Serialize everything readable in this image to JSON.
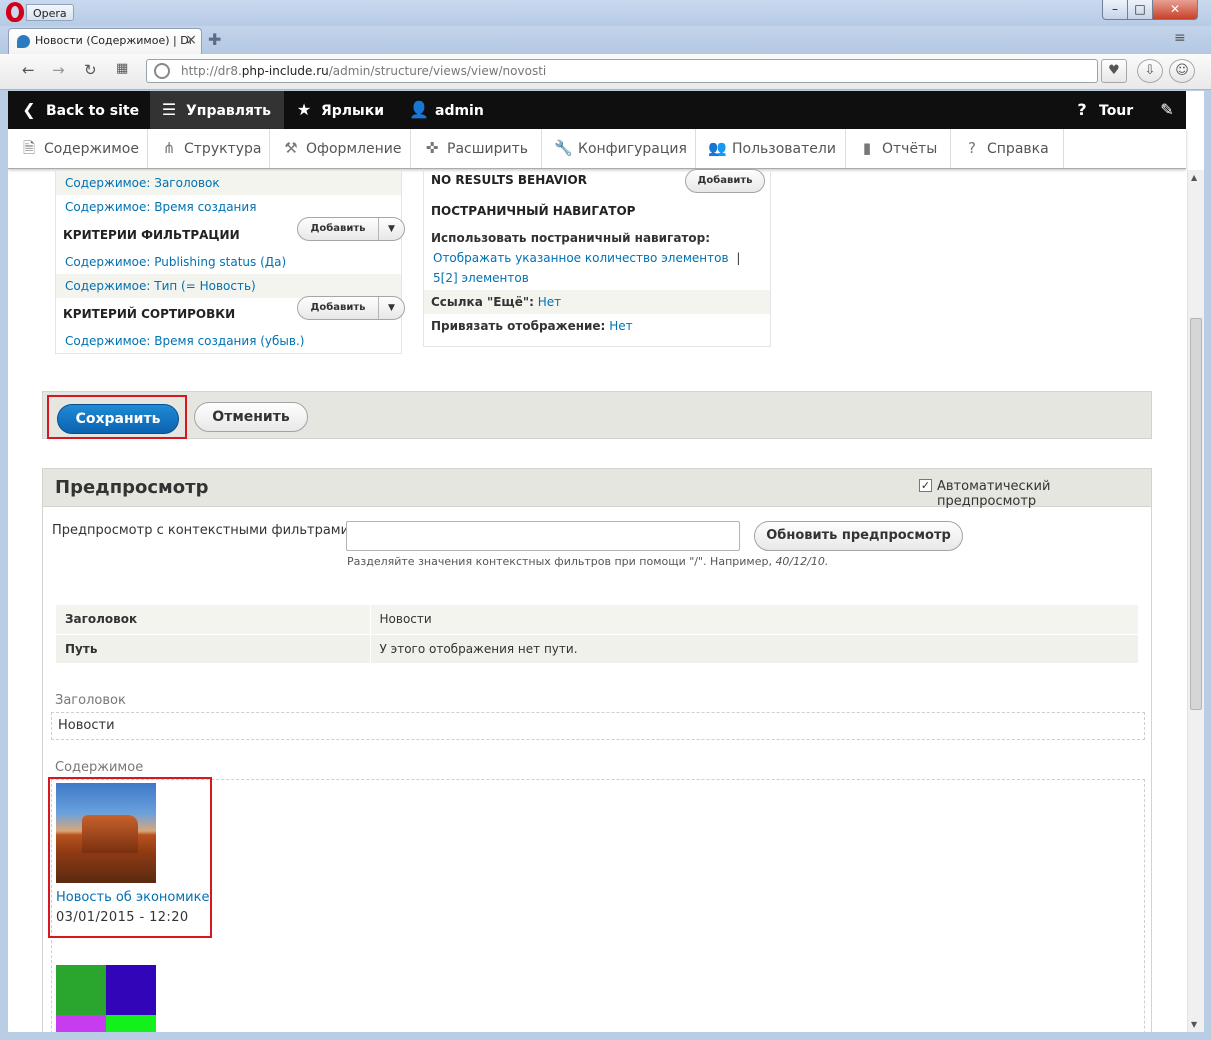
{
  "browser": {
    "app_name": "Opera",
    "tab_title": "Новости (Содержимое) | Dr",
    "url_prefix": "http://dr8.",
    "url_host": "php-include.ru",
    "url_path": "/admin/structure/views/view/novosti",
    "icons": [
      "back-icon",
      "forward-icon",
      "reload-icon",
      "speed-dial-icon",
      "heart-icon",
      "download-icon",
      "user-icon"
    ]
  },
  "toolbar": {
    "back_to_site": "Back to site",
    "manage": "Управлять",
    "shortcuts": "Ярлыки",
    "user": "admin",
    "tour": "Tour"
  },
  "tray": {
    "items": [
      {
        "label": "Содержимое",
        "icon": "document-icon"
      },
      {
        "label": "Структура",
        "icon": "sitemap-icon"
      },
      {
        "label": "Оформление",
        "icon": "wrench-brush-icon"
      },
      {
        "label": "Расширить",
        "icon": "puzzle-icon"
      },
      {
        "label": "Конфигурация",
        "icon": "wrench-icon"
      },
      {
        "label": "Пользователи",
        "icon": "people-icon"
      },
      {
        "label": "Отчёты",
        "icon": "bar-chart-icon"
      },
      {
        "label": "Справка",
        "icon": "help-icon"
      }
    ]
  },
  "views": {
    "fields": [
      "Содержимое: Заголовок",
      "Содержимое: Время создания"
    ],
    "filter_heading": "КРИТЕРИИ ФИЛЬТРАЦИИ",
    "filters": [
      "Содержимое: Publishing status (Да)",
      "Содержимое: Тип (= Новость)"
    ],
    "sort_heading": "КРИТЕРИЙ СОРТИРОВКИ",
    "sorts": [
      "Содержимое: Время создания (убыв.)"
    ],
    "add_label": "Добавить",
    "no_results_heading": "NO RESULTS BEHAVIOR",
    "pager_heading": "ПОСТРАНИЧНЫЙ НАВИГАТОР",
    "pager_use_label": "Использовать постраничный навигатор:",
    "pager_value": "Отображать указанное количество элементов",
    "pager_sep": "|",
    "pager_count": "5[2] элементов",
    "more_label": "Ссылка \"Ещё\":",
    "more_value": "Нет",
    "attach_label": "Привязать отображение:",
    "attach_value": "Нет"
  },
  "actions": {
    "save": "Сохранить",
    "cancel": "Отменить"
  },
  "preview": {
    "title": "Предпросмотр",
    "auto_label": "Автоматический предпросмотр",
    "auto_checked": true,
    "ctx_label": "Предпросмотр с контекстными фильтрами:",
    "ctx_value": "",
    "ctx_hint": "Разделяйте значения контекстных фильтров при помощи \"/\". Например,",
    "ctx_hint_example": "40/12/10.",
    "refresh": "Обновить предпросмотр",
    "table": [
      {
        "key": "Заголовок",
        "value": "Новости"
      },
      {
        "key": "Путь",
        "value": "У этого отображения нет пути."
      }
    ],
    "title_section_label": "Заголовок",
    "title_section_value": "Новости",
    "content_section_label": "Содержимое",
    "items": [
      {
        "title": "Новость об экономике",
        "date": "03/01/2015 - 12:20"
      }
    ],
    "colors": {
      "highlight": "#d7171f",
      "primary": "#0b62b0",
      "link": "#0071b3"
    }
  }
}
